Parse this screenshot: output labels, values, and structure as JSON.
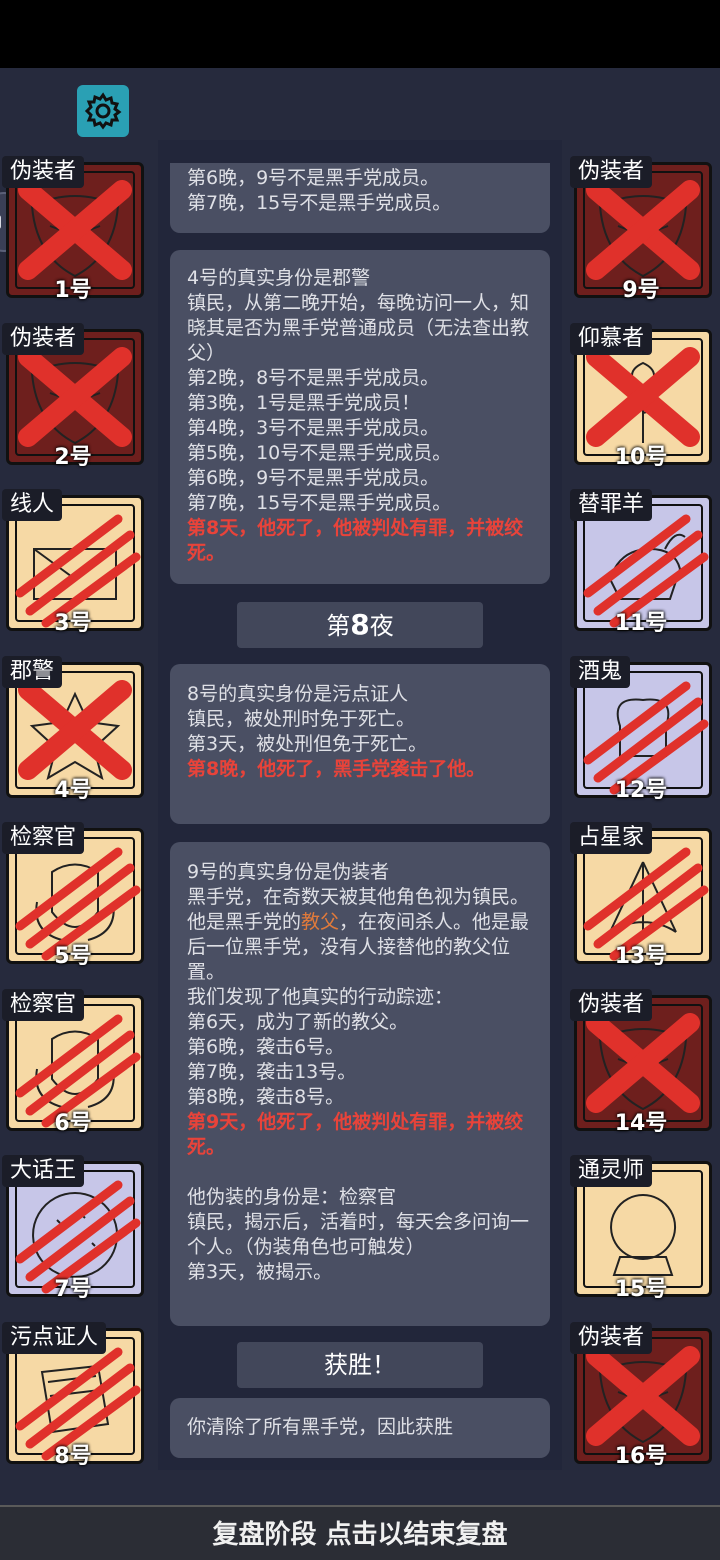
{
  "footer": {
    "label": "复盘阶段 点击以结束复盘"
  },
  "log": {
    "panel1": {
      "lines": [
        "第6晚，9号不是黑手党成员。",
        "第7晚，15号不是黑手党成员。"
      ]
    },
    "panel2": {
      "lines": [
        "4号的真实身份是郡警",
        "镇民，从第二晚开始，每晚访问一人，知晓其是否为黑手党普通成员（无法查出教父）",
        "第2晚，8号不是黑手党成员。",
        "第3晚，1号是黑手党成员！",
        "第4晚，3号不是黑手党成员。",
        "第5晚，10号不是黑手党成员。",
        "第6晚，9号不是黑手党成员。",
        "第7晚，15号不是黑手党成员。"
      ],
      "death": "第8天，他死了，他被判处有罪，并被绞死。"
    },
    "night_header": {
      "prefix": "第",
      "num": "8",
      "suffix": "夜"
    },
    "panel3": {
      "lines": [
        "8号的真实身份是污点证人",
        "镇民，被处刑时免于死亡。",
        "第3天，被处刑但免于死亡。"
      ],
      "death": "第8晚，他死了，黑手党袭击了他。"
    },
    "panel4": {
      "lines1": [
        "9号的真实身份是伪装者",
        "黑手党，在奇数天被其他角色视为镇民。"
      ],
      "godfather_pre": "他是黑手党的",
      "godfather_word": "教父",
      "godfather_post": "，在夜间杀人。他是最后一位黑手党，没有人接替他的教父位置。",
      "lines2": [
        "我们发现了他真实的行动踪迹：",
        "第6天，成为了新的教父。",
        "第6晚，袭击6号。",
        "第7晚，袭击13号。",
        "第8晚，袭击8号。"
      ],
      "death": "第9天，他死了，他被判处有罪，并被绞死。",
      "lines3": [
        "他伪装的身份是：检察官",
        "镇民，揭示后，活着时，每天会多问询一个人。（伪装角色也可触发）",
        "第3天，被揭示。"
      ]
    },
    "victory_header": "获胜！",
    "panel5": {
      "lines": [
        "你清除了所有黑手党，因此获胜"
      ]
    }
  },
  "players_left": [
    {
      "role": "伪装者",
      "seat": "1号",
      "team": "wolf",
      "mark": "x",
      "icon": "mask-icon"
    },
    {
      "role": "伪装者",
      "seat": "2号",
      "team": "wolf",
      "mark": "x",
      "icon": "mask-icon"
    },
    {
      "role": "线人",
      "seat": "3号",
      "team": "town",
      "mark": "claw",
      "icon": "envelope-icon"
    },
    {
      "role": "郡警",
      "seat": "4号",
      "team": "town",
      "mark": "x",
      "icon": "badge-icon"
    },
    {
      "role": "检察官",
      "seat": "5号",
      "team": "town",
      "mark": "claw",
      "icon": "emblem-icon"
    },
    {
      "role": "检察官",
      "seat": "6号",
      "team": "town",
      "mark": "claw",
      "icon": "emblem-icon"
    },
    {
      "role": "大话王",
      "seat": "7号",
      "team": "neutral",
      "mark": "claw",
      "icon": "cookie-icon"
    },
    {
      "role": "污点证人",
      "seat": "8号",
      "team": "town",
      "mark": "claw",
      "icon": "papers-icon"
    }
  ],
  "players_right": [
    {
      "role": "伪装者",
      "seat": "9号",
      "team": "wolf",
      "mark": "x",
      "icon": "mask-icon"
    },
    {
      "role": "仰慕者",
      "seat": "10号",
      "team": "town",
      "mark": "x",
      "icon": "rose-icon"
    },
    {
      "role": "替罪羊",
      "seat": "11号",
      "team": "neutral",
      "mark": "claw",
      "icon": "goat-icon"
    },
    {
      "role": "酒鬼",
      "seat": "12号",
      "team": "neutral",
      "mark": "claw",
      "icon": "chef-icon"
    },
    {
      "role": "占星家",
      "seat": "13号",
      "team": "town",
      "mark": "claw",
      "icon": "sextant-icon"
    },
    {
      "role": "伪装者",
      "seat": "14号",
      "team": "wolf",
      "mark": "x",
      "icon": "mask-icon"
    },
    {
      "role": "通灵师",
      "seat": "15号",
      "team": "town",
      "mark": "none",
      "icon": "crystal-ball-icon"
    },
    {
      "role": "伪装者",
      "seat": "16号",
      "team": "wolf",
      "mark": "x",
      "icon": "mask-icon"
    }
  ],
  "colors": {
    "wolf": "#6e1f1d",
    "town": "#f6d9a5",
    "neutral": "#c7c6e8",
    "mark": "#e0312b",
    "panel": "#4a4f63",
    "accent": "#2aa0b4"
  }
}
